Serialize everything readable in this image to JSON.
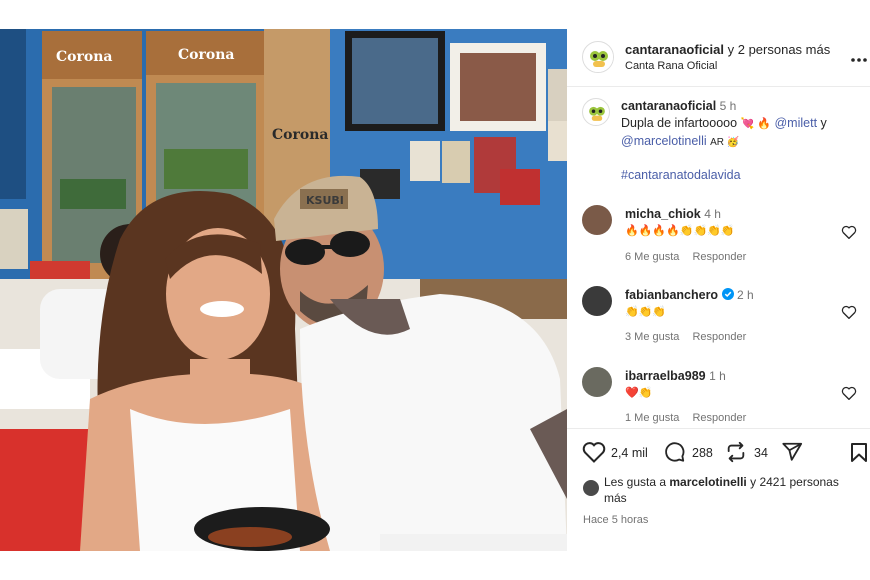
{
  "header": {
    "account": "cantaranaoficial",
    "collab_suffix": "y 2 personas más",
    "subtitle": "Canta Rana Oficial",
    "more_icon": "more-horizontal-icon"
  },
  "caption": {
    "username": "cantaranaoficial",
    "time": "5 h",
    "text": "Dupla de infartooooo",
    "emojis": "💘 🔥",
    "mention1": "@milett",
    "and": "y",
    "mention2": "@marcelotinelli",
    "flag": "AR 🥳",
    "hashtag": "#cantaranatodalavida"
  },
  "comments": [
    {
      "username": "micha_chiok",
      "time": "4 h",
      "verified": false,
      "text": "🔥🔥🔥🔥👏👏👏👏",
      "likes": "6 Me gusta",
      "reply": "Responder"
    },
    {
      "username": "fabianbanchero",
      "time": "2 h",
      "verified": true,
      "text": "👏👏👏",
      "likes": "3 Me gusta",
      "reply": "Responder"
    },
    {
      "username": "ibarraelba989",
      "time": "1 h",
      "verified": false,
      "text": "❤️👏",
      "likes": "1 Me gusta",
      "reply": "Responder"
    }
  ],
  "actions": {
    "likes_count": "2,4 mil",
    "comments_count": "288",
    "reposts_count": "34"
  },
  "liked_by": {
    "prefix": "Les gusta a",
    "user": "marcelotinelli",
    "suffix": "y 2421 personas",
    "suffix2": "más"
  },
  "posted": "Hace 5 horas",
  "photo_text": {
    "brand1": "Corona",
    "brand2": "Corona",
    "brand3": "Corona",
    "cap": "KSUBI"
  },
  "colors": {
    "like_red": "#ed4956",
    "link_blue": "#4a5ea8",
    "verified_blue": "#0095f6"
  }
}
